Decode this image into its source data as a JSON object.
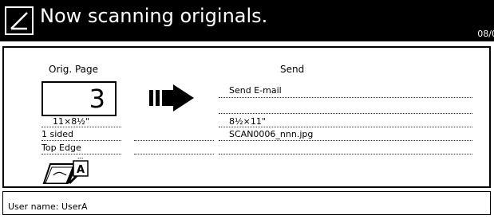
{
  "header": {
    "title": "Now scanning originals.",
    "date": "08/0",
    "icon": "document-edit-icon"
  },
  "original": {
    "label": "Orig. Page",
    "page_count": "3",
    "size": "11×8½\"",
    "sides": "1 sided",
    "orientation": "Top Edge"
  },
  "destination": {
    "label": "Send",
    "method": "Send E-mail",
    "size": "8½×11\"",
    "filename": "SCAN0006_nnn.jpg"
  },
  "status": {
    "user_label": "User name:",
    "user_name": "UserA"
  }
}
